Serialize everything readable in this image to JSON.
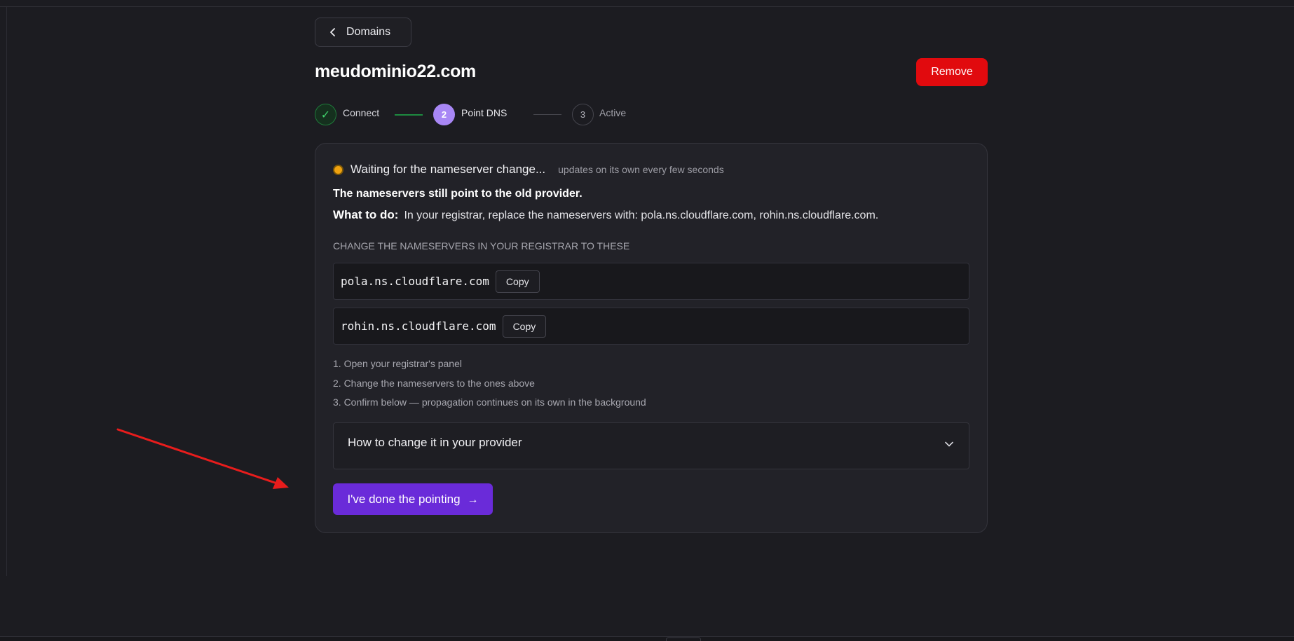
{
  "nav": {
    "back_label": "Domains"
  },
  "domain": {
    "name": "meudominio22.com",
    "remove_label": "Remove"
  },
  "stepper": {
    "steps": [
      {
        "marker": "✓",
        "label": "Connect",
        "state": "done"
      },
      {
        "marker": "2",
        "label": "Point DNS",
        "state": "current"
      },
      {
        "marker": "3",
        "label": "Active",
        "state": "pending"
      }
    ]
  },
  "status": {
    "title": "Waiting for the nameserver change...",
    "subtitle": "updates on its own every few seconds",
    "color": "#efa20f"
  },
  "problem": "The nameservers still point to the old provider.",
  "todo": {
    "label": "What to do:",
    "text": "In your registrar, replace the nameservers with: pola.ns.cloudflare.com, rohin.ns.cloudflare.com."
  },
  "nameservers": {
    "heading": "CHANGE THE NAMESERVERS IN YOUR REGISTRAR TO THESE",
    "items": [
      {
        "value": "pola.ns.cloudflare.com",
        "copy_label": "Copy"
      },
      {
        "value": "rohin.ns.cloudflare.com",
        "copy_label": "Copy"
      }
    ]
  },
  "instructions": [
    "1. Open your registrar's panel",
    "2. Change the nameservers to the ones above",
    "3. Confirm below — propagation continues on its own in the background"
  ],
  "accordion": {
    "title": "How to change it in your provider",
    "icon": "chevron-down-icon"
  },
  "confirm": {
    "label": "I've done the pointing",
    "arrow": "→",
    "color": "#6a2bd9"
  },
  "colors": {
    "background": "#1c1c21",
    "card": "#222228",
    "danger": "#e10a0e",
    "success": "#3fcf6a",
    "step_active": "#a887f5",
    "annotation": "#e81c1c"
  }
}
